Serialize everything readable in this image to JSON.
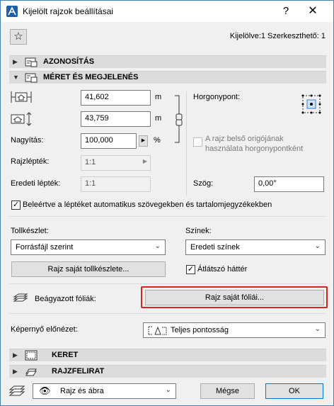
{
  "window": {
    "title": "Kijelölt rajzok beállításai",
    "help_label": "?",
    "close_label": "✕"
  },
  "header": {
    "favorite_icon": "star-icon",
    "selection_info": "Kijelölve:1 Szerkeszthető: 1"
  },
  "sections": {
    "id": {
      "title": "AZONOSÍTÁS",
      "icon": "tag-icon"
    },
    "size": {
      "title": "MÉRET ÉS MEGJELENÉS",
      "icon": "size-icon"
    },
    "frame": {
      "title": "KERET",
      "icon": "frame-icon"
    },
    "caption": {
      "title": "RAJZFELIRAT",
      "icon": "caption-icon"
    }
  },
  "size": {
    "width_value": "41,602",
    "width_unit": "m",
    "height_value": "43,759",
    "height_unit": "m",
    "magnification_label": "Nagyítás:",
    "magnification_value": "100,000",
    "magnification_unit": "%",
    "scale_label": "Rajzlépték:",
    "scale_value": "1:1",
    "original_scale_label": "Eredeti lépték:",
    "original_scale_value": "1:1",
    "anchor_label": "Horgonypont:",
    "origin_anchor_label": "A rajz belső origójának használata horgonypontként",
    "angle_label": "Szög:",
    "angle_value": "0,00°",
    "include_scale_label": "Beleértve a léptéket automatikus szövegekben és tartalomjegyzékekben",
    "include_scale_checked": true
  },
  "pens": {
    "label": "Tollkészlet:",
    "value": "Forrásfájl szerint",
    "own_button": "Rajz saját tollkészlete..."
  },
  "colors": {
    "label": "Színek:",
    "value": "Eredeti színek",
    "transparent_label": "Átlátszó háttér",
    "transparent_checked": true
  },
  "layers": {
    "label": "Beágyazott fóliák:",
    "own_button": "Rajz saját fóliái..."
  },
  "preview": {
    "label": "Képernyő előnézet:",
    "value": "Teljes pontosság"
  },
  "footer": {
    "view_value": "Rajz és ábra",
    "cancel_label": "Mégse",
    "ok_label": "OK"
  }
}
